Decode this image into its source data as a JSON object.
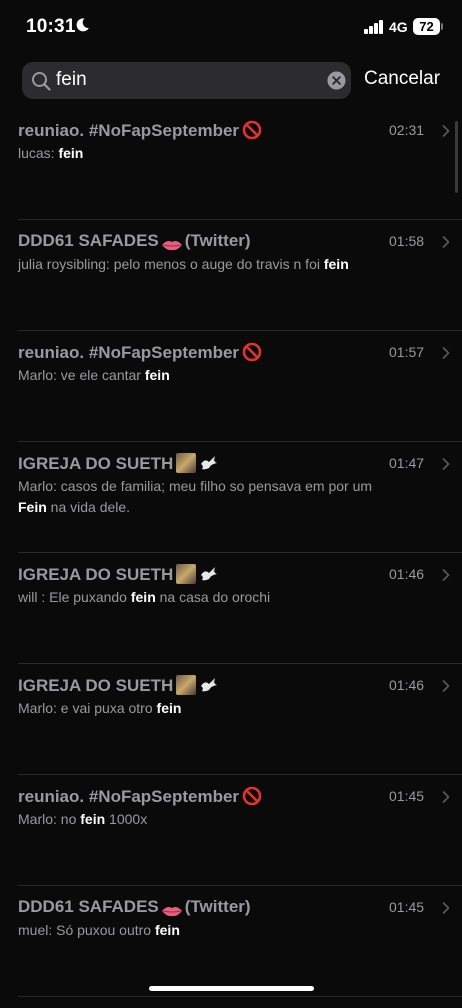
{
  "status": {
    "time": "10:31",
    "network": "4G",
    "battery": "72"
  },
  "search": {
    "query": "fein",
    "cancel_label": "Cancelar"
  },
  "rows": [
    {
      "title": "reuniao. #NoFapSeptember",
      "title_suffix": "",
      "emoji": "no-entry-emoji",
      "sender": "lucas:",
      "before": "",
      "match": "fein",
      "after": "",
      "time": "02:31"
    },
    {
      "title": "DDD61 SAFADES",
      "title_suffix": "(Twitter)",
      "emoji": "lips-emoji",
      "sender": "julia roysibling:",
      "before": "pelo menos o auge do travis n foi",
      "match": "fein",
      "after": "",
      "time": "01:58"
    },
    {
      "title": "reuniao. #NoFapSeptember",
      "title_suffix": "",
      "emoji": "no-entry-emoji",
      "sender": "Marlo:",
      "before": "ve ele cantar",
      "match": "fein",
      "after": "",
      "time": "01:57"
    },
    {
      "title": "IGREJA DO SUETH",
      "title_suffix": "",
      "emoji": "picture-dove-emoji",
      "sender": "Marlo:",
      "before": "casos de familia; meu filho so pensava em por um",
      "match": "Fein",
      "after": "na vida dele.",
      "time": "01:47"
    },
    {
      "title": "IGREJA DO SUETH",
      "title_suffix": "",
      "emoji": "picture-dove-emoji",
      "sender": "will :",
      "before": "Ele puxando",
      "match": "fein",
      "after": "na casa do orochi",
      "time": "01:46"
    },
    {
      "title": "IGREJA DO SUETH",
      "title_suffix": "",
      "emoji": "picture-dove-emoji",
      "sender": "Marlo:",
      "before": "e vai puxa otro",
      "match": "fein",
      "after": "",
      "time": "01:46"
    },
    {
      "title": "reuniao. #NoFapSeptember",
      "title_suffix": "",
      "emoji": "no-entry-emoji",
      "sender": "Marlo:",
      "before": "no",
      "match": "fein",
      "after": "1000x",
      "time": "01:45"
    },
    {
      "title": "DDD61 SAFADES",
      "title_suffix": "(Twitter)",
      "emoji": "lips-emoji",
      "sender": "muel:",
      "before": "Só puxou outro",
      "match": "fein",
      "after": "",
      "time": "01:45"
    }
  ]
}
